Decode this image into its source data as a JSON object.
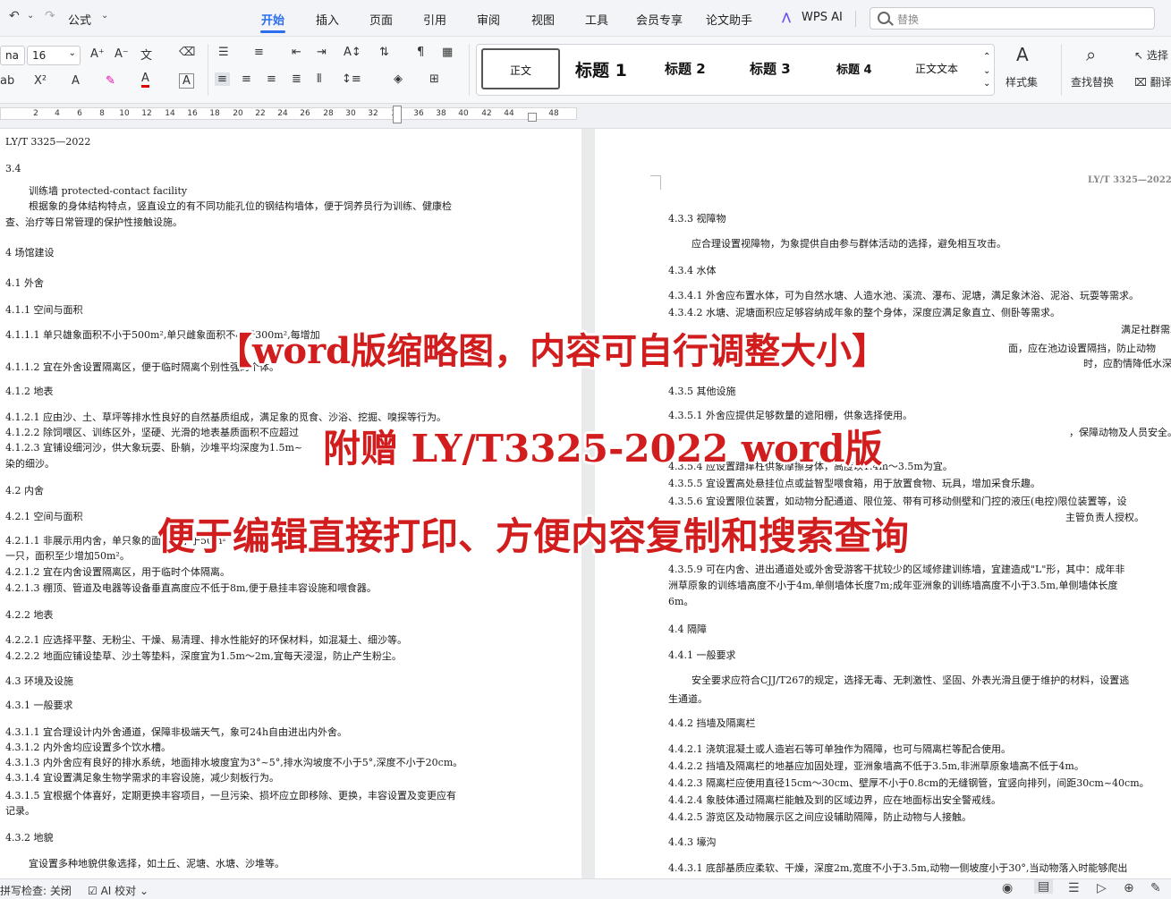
{
  "menubar": {
    "undo_icon": "undo-icon",
    "format_painter": "公式",
    "tabs": [
      "开始",
      "插入",
      "页面",
      "引用",
      "审阅",
      "视图",
      "工具",
      "会员专享",
      "论文助手",
      "WPS AI"
    ],
    "active_tab": "开始",
    "search_placeholder": "替换"
  },
  "ribbon": {
    "font_name": "na",
    "font_size": "16",
    "styles": [
      "正文",
      "标题 1",
      "标题 2",
      "标题 3",
      "标题 4",
      "正文文本"
    ],
    "styles_set_label": "样式集",
    "find_replace_label": "查找替换",
    "select_label": "选择",
    "translate_label": "翻译"
  },
  "ruler": {
    "ticks": [
      "2",
      "4",
      "6",
      "8",
      "10",
      "12",
      "14",
      "16",
      "18",
      "20",
      "22",
      "24",
      "26",
      "28",
      "30",
      "32",
      "34",
      "36",
      "38",
      "40",
      "42",
      "44",
      "48"
    ]
  },
  "page1": {
    "header": "LY/T 3325—2022",
    "lines": [
      "3.4",
      "训练墙  protected-contact facility",
      "根据象的身体结构特点，竖直设立的有不同功能孔位的钢结构墙体，便于饲养员行为训练、健康检",
      "查、治疗等日常管理的保护性接触设施。",
      "4  场馆建设",
      "4.1  外舍",
      "4.1.1  空间与面积",
      "4.1.1.1  单只雄象面积不小于500m²,单只雌象面积不小于300m²,每增加",
      "4.1.1.2  宜在外舍设置隔离区，便于临时隔离个别性强的个体。",
      "4.1.2  地表",
      "4.1.2.1  应由沙、土、草坪等排水性良好的自然基质组成，满足象的觅食、沙浴、挖掘、嗅探等行为。",
      "4.1.2.2  除饲喂区、训练区外，坚硬、光滑的地表基质面积不应超过",
      "4.1.2.3  宜铺设细河沙，供大象玩耍、卧躺，沙堆平均深度为1.5m~",
      "染的细沙。",
      "4.2  内舍",
      "4.2.1  空间与面积",
      "4.2.1.1  非展示用内舍，单只象的面积不小于50m²",
      "一只，面积至少增加50m²。",
      "4.2.1.2  宜在内舍设置隔离区，用于临时个体隔离。",
      "4.2.1.3  棚顶、管道及电器等设备垂直高度应不低于8m,便于悬挂丰容设施和喂食器。",
      "4.2.2  地表",
      "4.2.2.1  应选择平整、无粉尘、干燥、易清理、排水性能好的环保材料，如混凝土、细沙等。",
      "4.2.2.2  地面应铺设垫草、沙土等垫料，深度宜为1.5m～2m,宜每天浸湿，防止产生粉尘。",
      "4.3  环境及设施",
      "4.3.1  一般要求",
      "4.3.1.1  宜合理设计内外舍通道，保障非极端天气，象可24h自由进出内外舍。",
      "4.3.1.2  内外舍均应设置多个饮水槽。",
      "4.3.1.3  内外舍应有良好的排水系统，地面排水坡度宜为3°~5°,排水沟坡度不小于5°,深度不小于20cm。",
      "4.3.1.4  宜设置满足象生物学需求的丰容设施，减少刻板行为。",
      "4.3.1.5  宜根据个体喜好，定期更换丰容项目，一旦污染、损坏应立即移除、更换，丰容设置及变更应有",
      "记录。",
      "4.3.2  地貌",
      "宜设置多种地貌供象选择，如土丘、泥塘、水塘、沙堆等。"
    ]
  },
  "page2": {
    "header": "LY/T 3325—2022",
    "lines": [
      "4.3.3  视障物",
      "应合理设置视障物，为象提供自由参与群体活动的选择，避免相互攻击。",
      "4.3.4  水体",
      "4.3.4.1  外舍应布置水体，可为自然水塘、人造水池、溪流、瀑布、泥塘，满足象沐浴、泥浴、玩耍等需求。",
      "4.3.4.2  水塘、泥塘面积应足够容纳成年象的整个身体，深度应满足象直立、侧卧等需求。",
      "满足社群需求。",
      "面，应在池边设置隔挡，防止动物",
      "时，应酌情降低水深。",
      "4.3.5  其他设施",
      "4.3.5.1  外舍应提供足够数量的遮阳棚，供象选择使用。",
      "，保障动物及人员安全。",
      "4.3.5.4  应设置蹭痒柱供象摩擦身体，高度以1.4m～3.5m为宜。",
      "4.3.5.5  宜设置高处悬挂位点或益智型喂食箱，用于放置食物、玩具，增加采食乐趣。",
      "4.3.5.6  宜设置限位装置，如动物分配通道、限位笼、带有可移动侧壁和门控的液压(电控)限位装置等，设",
      "主管负责人授权。",
      "4.3.5.9  可在内舍、进出通道处或外舍受游客干扰较少的区域修建训练墙，宜建造成\"L\"形，其中：成年非",
      "洲草原象的训练墙高度不小于4m,单侧墙体长度7m;成年亚洲象的训练墙高度不小于3.5m,单侧墙体长度",
      "6m。",
      "4.4  隔障",
      "4.4.1  一般要求",
      "安全要求应符合CJJ/T267的规定，选择无毒、无刺激性、坚固、外表光滑且便于维护的材料，设置逃",
      "生通道。",
      "4.4.2  挡墙及隔离栏",
      "4.4.2.1  浇筑混凝土或人造岩石等可单独作为隔障，也可与隔离栏等配合使用。",
      "4.4.2.2  挡墙及隔离栏的地基应加固处理，亚洲象墙高不低于3.5m,非洲草原象墙高不低于4m。",
      "4.4.2.3  隔离栏应使用直径15cm～30cm、壁厚不小于0.8cm的无缝钢管，宜竖向排列，间距30cm~40cm。",
      "4.4.2.4  象肢体通过隔离栏能触及到的区域边界，应在地面标出安全警戒线。",
      "4.4.2.5  游览区及动物展示区之间应设辅助隔障，防止动物与人接触。",
      "4.4.3  壕沟",
      "4.4.3.1  底部基质应柔软、干燥，深度2m,宽度不小于3.5m,动物一侧坡度小于30°,当动物落入时能够爬出"
    ]
  },
  "overlay": {
    "line1": "【word版缩略图，内容可自行调整大小】",
    "line2": "附赠 LY/T3325-2022 word版",
    "line3": "便于编辑直接打印、方便内容复制和搜索查询"
  },
  "status": {
    "spellcheck": "拼写检查: 关闭",
    "ai_check": "AI 校对"
  },
  "colors": {
    "accent": "#2b6ef0",
    "overlay_red": "#d11d1d"
  }
}
